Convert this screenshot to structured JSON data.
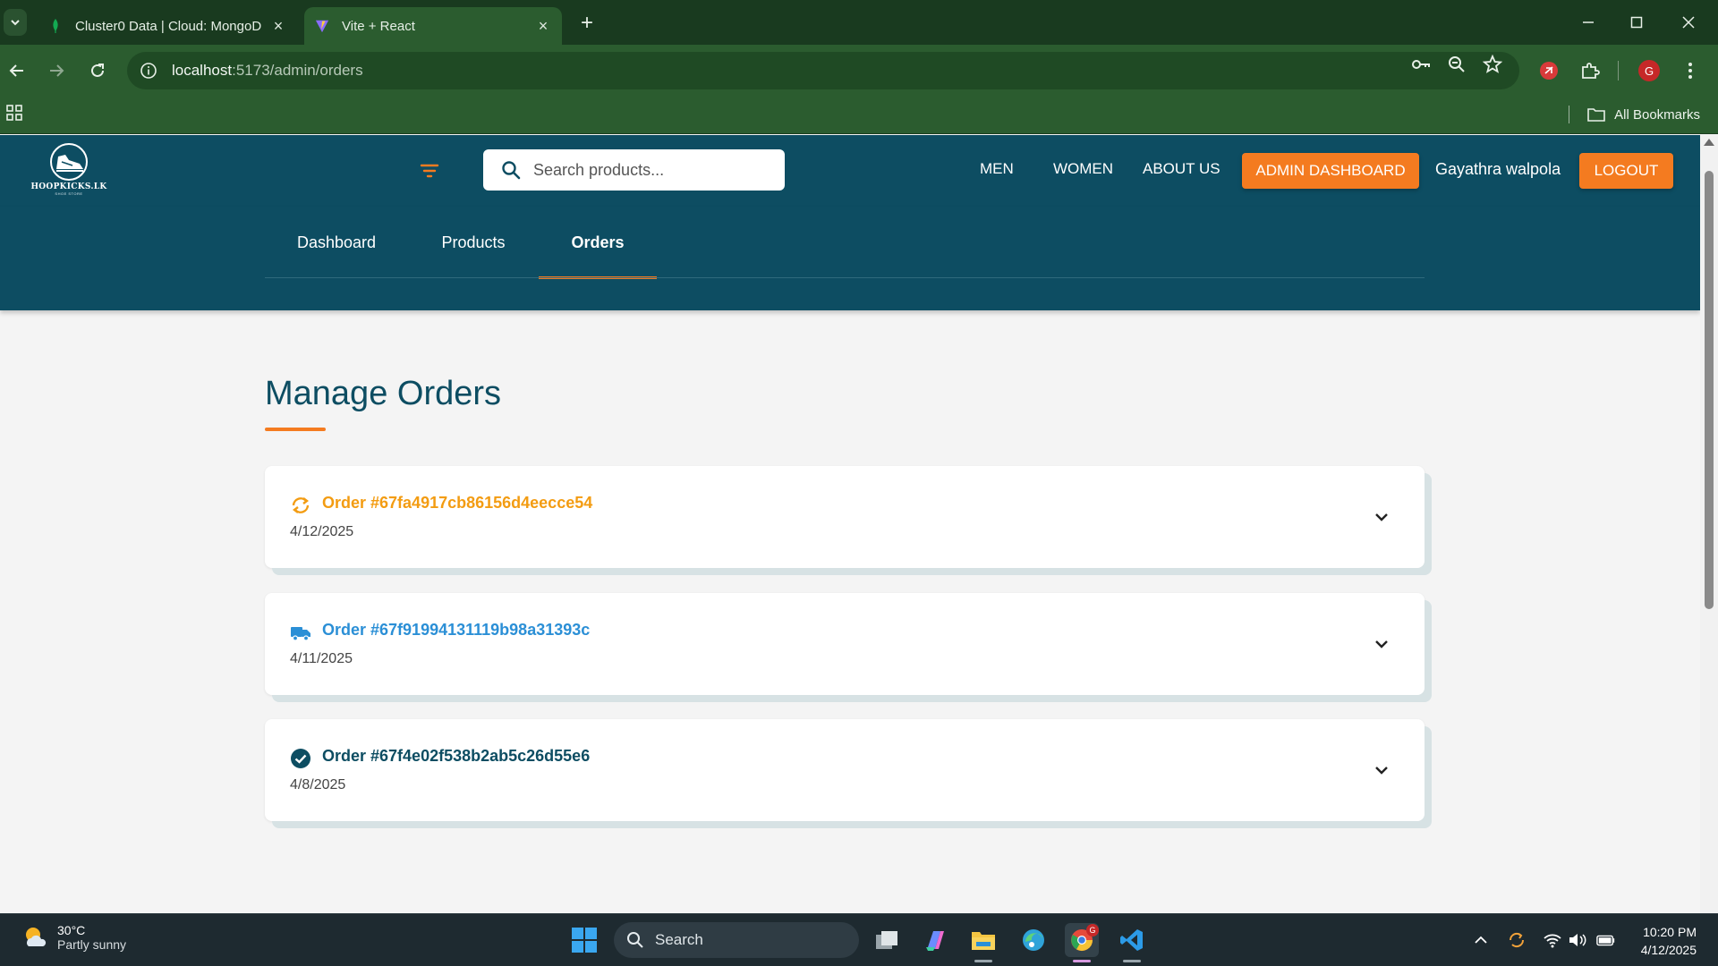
{
  "browser": {
    "tabs": [
      {
        "title": "Cluster0 Data | Cloud: MongoD",
        "active": false
      },
      {
        "title": "Vite + React",
        "active": true
      }
    ],
    "url_host": "localhost",
    "url_path": ":5173/admin/orders",
    "bookmarks_label": "All Bookmarks",
    "profile_initial": "G"
  },
  "site": {
    "logo_text": "HOOPKICKS.LK",
    "logo_sub": "SHOE STORE",
    "search_placeholder": "Search products...",
    "nav": {
      "men": "MEN",
      "women": "WOMEN",
      "about": "ABOUT US"
    },
    "admin_button": "ADMIN DASHBOARD",
    "user_name": "Gayathra walpola",
    "logout_button": "LOGOUT",
    "brand_color": "#0d4d62",
    "accent_color": "#f47b20"
  },
  "admin_tabs": [
    {
      "label": "Dashboard",
      "active": false
    },
    {
      "label": "Products",
      "active": false
    },
    {
      "label": "Orders",
      "active": true
    }
  ],
  "page": {
    "title": "Manage Orders"
  },
  "orders": [
    {
      "title": "Order #67fa4917cb86156d4eecce54",
      "date": "4/12/2025",
      "status_icon": "processing-icon",
      "color": "#f39c12"
    },
    {
      "title": "Order #67f91994131119b98a31393c",
      "date": "4/11/2025",
      "status_icon": "truck-icon",
      "color": "#2b8fd6"
    },
    {
      "title": "Order #67f4e02f538b2ab5c26d55e6",
      "date": "4/8/2025",
      "status_icon": "check-circle-icon",
      "color": "#0d4d62"
    }
  ],
  "taskbar": {
    "weather_temp": "30°C",
    "weather_desc": "Partly sunny",
    "search_label": "Search",
    "time": "10:20 PM",
    "date": "4/12/2025",
    "chrome_badge": "G"
  }
}
